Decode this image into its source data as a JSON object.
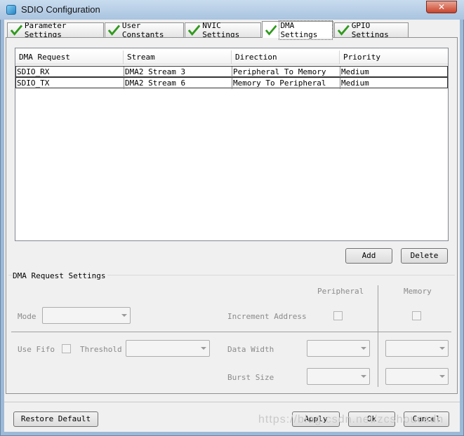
{
  "window": {
    "title": "SDIO Configuration",
    "close_glyph": "✕",
    "app_icon": "cube-icon"
  },
  "tabs": [
    {
      "label": "Parameter Settings",
      "active": false
    },
    {
      "label": "User Constants",
      "active": false
    },
    {
      "label": "NVIC Settings",
      "active": false
    },
    {
      "label": "DMA Settings",
      "active": true
    },
    {
      "label": "GPIO Settings",
      "active": false
    }
  ],
  "table": {
    "columns": [
      "DMA Request",
      "Stream",
      "Direction",
      "Priority"
    ],
    "rows": [
      [
        "SDIO_RX",
        "DMA2 Stream 3",
        "Peripheral To Memory",
        "Medium"
      ],
      [
        "SDIO_TX",
        "DMA2 Stream 6",
        "Memory To Peripheral",
        "Medium"
      ]
    ]
  },
  "buttons": {
    "add": "Add",
    "delete": "Delete",
    "restore": "Restore Default",
    "apply": "Apply",
    "ok": "Ok",
    "cancel": "Cancel"
  },
  "settings": {
    "group_label": "DMA Request Settings",
    "peripheral": "Peripheral",
    "memory": "Memory",
    "mode": "Mode",
    "increment_address": "Increment Address",
    "use_fifo": "Use Fifo",
    "threshold": "Threshold",
    "data_width": "Data Width",
    "burst_size": "Burst Size"
  },
  "watermark": "https://blog.csdn.net/zcshoucsdn"
}
